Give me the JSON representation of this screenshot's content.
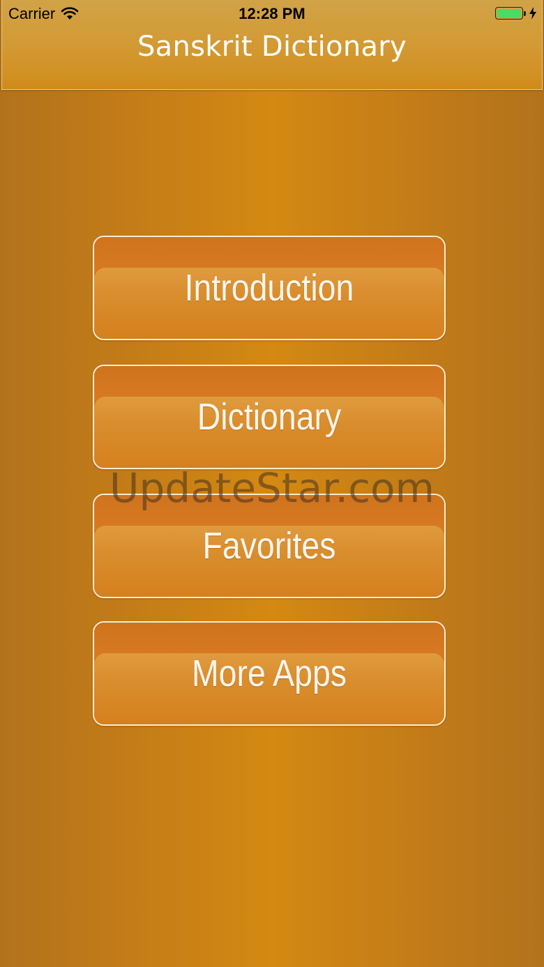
{
  "status_bar": {
    "carrier": "Carrier",
    "time": "12:28 PM",
    "battery_color": "#4cd964"
  },
  "nav_bar": {
    "title": "Sanskrit Dictionary"
  },
  "menu": {
    "items": [
      {
        "label": "Introduction"
      },
      {
        "label": "Dictionary"
      },
      {
        "label": "Favorites"
      },
      {
        "label": "More Apps"
      }
    ]
  },
  "watermark": {
    "text": "UpdateStar.com"
  },
  "colors": {
    "background": "#d48912",
    "button_top": "#d2731f",
    "button_bottom": "#df9b3f",
    "button_border": "#fbecd2",
    "nav_bar": "#d39a34"
  },
  "icons": {
    "wifi": "wifi-icon",
    "battery": "battery-icon",
    "charging": "bolt-icon"
  }
}
